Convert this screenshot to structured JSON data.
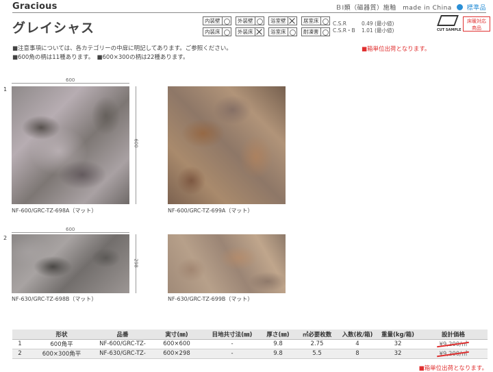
{
  "header": {
    "title_en": "Gracious",
    "title_jp": "グレイシャス",
    "class_text": "ＢⅠ類（磁器質）施釉　made in China",
    "standard_label": "標準品",
    "cut_sample": "CUT SAMPLE",
    "floor_box": [
      "床暖対応",
      "商品"
    ]
  },
  "usage": [
    {
      "label": "内装壁",
      "mark": "ok"
    },
    {
      "label": "外装壁",
      "mark": "ok"
    },
    {
      "label": "浴室壁",
      "mark": "ng"
    },
    {
      "label": "居室床",
      "mark": "ok"
    },
    {
      "label": "内装床",
      "mark": "ok"
    },
    {
      "label": "外装床",
      "mark": "ng"
    },
    {
      "label": "浴室床",
      "mark": "ok"
    },
    {
      "label": "耐凍害",
      "mark": "ok"
    }
  ],
  "csr": [
    {
      "key": "C.S.R",
      "value": "0.49 (最小値)"
    },
    {
      "key": "C.S.R・B",
      "value": "1.01 (最小値)"
    }
  ],
  "notes": [
    "■注意事項については、各カテゴリーの中扉に明記してあります。ご参照ください。",
    "■600角の柄は11種あります。　■600×300の柄は22種あります。"
  ],
  "red_note": "■箱単位出荷となります。",
  "rows": [
    {
      "num": "1",
      "dim_top": "600",
      "dim_side": "600",
      "tiles": [
        {
          "label": "NF-600/GRC-TZ-698A（マット）"
        },
        {
          "label": "NF-600/GRC-TZ-699A（マット）"
        }
      ]
    },
    {
      "num": "2",
      "dim_top": "600",
      "dim_side": "298",
      "tiles": [
        {
          "label": "NF-630/GRC-TZ-698B（マット）"
        },
        {
          "label": "NF-630/GRC-TZ-699B（マット）"
        }
      ]
    }
  ],
  "table": {
    "headers": [
      "",
      "形状",
      "品番",
      "実寸(㎜)",
      "目地共寸法(㎜)",
      "厚さ(㎜)",
      "㎡必要枚数",
      "入数(枚/箱)",
      "重量(kg/箱)",
      "設計価格"
    ],
    "rows": [
      [
        "1",
        "600角平",
        "NF-600/GRC-TZ-",
        "600×600",
        "-",
        "9.8",
        "2.75",
        "4",
        "32",
        "¥9,200/㎡"
      ],
      [
        "2",
        "600×300角平",
        "NF-630/GRC-TZ-",
        "600×298",
        "-",
        "9.8",
        "5.5",
        "8",
        "32",
        "¥9,200/㎡"
      ]
    ]
  },
  "bottom_note": "■箱単位出荷となります。"
}
